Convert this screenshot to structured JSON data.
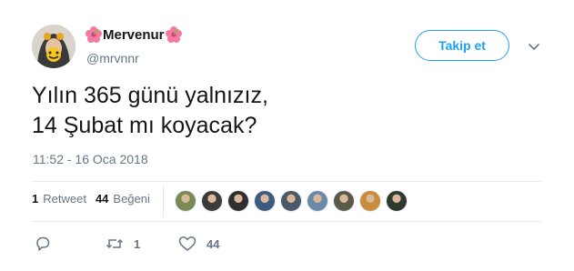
{
  "user": {
    "display_name": "Mervenur",
    "handle": "@mrvnnr",
    "decoration_icon": "hibiscus-icon"
  },
  "follow_button": {
    "label": "Takip et"
  },
  "tweet": {
    "lines": [
      "Yılın 365 günü yalnızız,",
      "14 Şubat mı koyacak?"
    ],
    "timestamp": "11:52 - 16 Oca 2018"
  },
  "stats": {
    "retweets": {
      "count": "1",
      "label": "Retweet"
    },
    "likes": {
      "count": "44",
      "label": "Beğeni"
    }
  },
  "likers": [
    {
      "color": "#7a8a55"
    },
    {
      "color": "#3b3b3b"
    },
    {
      "color": "#2f2f2f"
    },
    {
      "color": "#3d5a80"
    },
    {
      "color": "#4a5a6a"
    },
    {
      "color": "#6a8aa8"
    },
    {
      "color": "#5a5a4a"
    },
    {
      "color": "#c98b3c"
    },
    {
      "color": "#2e3a2e"
    }
  ],
  "actions": {
    "reply": {
      "icon": "reply-icon",
      "count": ""
    },
    "retweet": {
      "icon": "retweet-icon",
      "count": "1"
    },
    "like": {
      "icon": "heart-icon",
      "count": "44"
    }
  },
  "colors": {
    "accent": "#1da1f2",
    "text": "#14171a",
    "muted": "#657786",
    "border": "#e6ecf0"
  }
}
